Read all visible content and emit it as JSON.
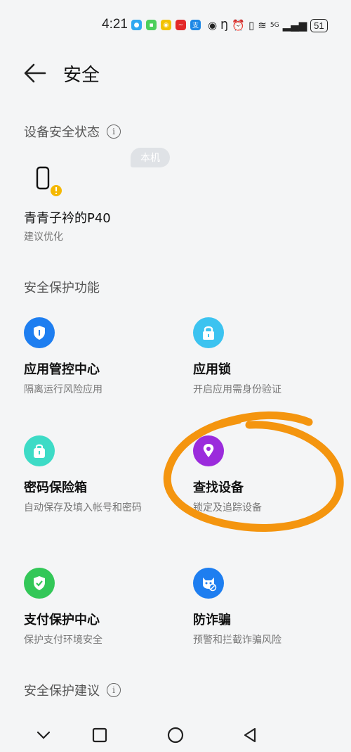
{
  "status_bar": {
    "time": "4:21",
    "battery": "51",
    "network": "5G"
  },
  "header": {
    "title": "安全"
  },
  "device_section": {
    "title": "设备安全状态",
    "badge": "本机",
    "device_name": "青青子衿的P40",
    "device_status": "建议优化"
  },
  "features_section": {
    "title": "安全保护功能",
    "items": [
      {
        "name": "应用管控中心",
        "desc": "隔离运行风险应用",
        "icon": "shield-icon",
        "color": "#1e7ef0"
      },
      {
        "name": "应用锁",
        "desc": "开启应用需身份验证",
        "icon": "lock-icon",
        "color": "#3cc3f0"
      },
      {
        "name": "密码保险箱",
        "desc": "自动保存及填入帐号和密码",
        "icon": "safe-icon",
        "color": "#3ddbc6"
      },
      {
        "name": "查找设备",
        "desc": "锁定及追踪设备",
        "icon": "location-pin-icon",
        "color": "#9b2bdc"
      },
      {
        "name": "支付保护中心",
        "desc": "保护支付环境安全",
        "icon": "shield-check-icon",
        "color": "#33c758"
      },
      {
        "name": "防诈骗",
        "desc": "预警和拦截诈骗风险",
        "icon": "anti-fraud-icon",
        "color": "#1e7ef0"
      }
    ]
  },
  "suggestions_section": {
    "title": "安全保护建议"
  },
  "colors": {
    "annotation": "#f4950f",
    "warning": "#f5b800"
  }
}
